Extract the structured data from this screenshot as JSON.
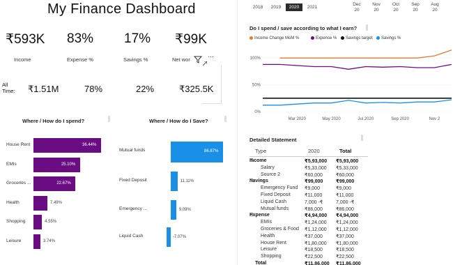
{
  "title": "My Finance Dashboard",
  "kpis": [
    {
      "value": "₹593K",
      "label": "Income"
    },
    {
      "value": "83%",
      "label": "Expense %"
    },
    {
      "value": "17%",
      "label": "Savings %"
    },
    {
      "value": "₹99K",
      "label": "Net wor"
    }
  ],
  "alltime": {
    "label": "All\nTime:",
    "values": [
      "₹1.51M",
      "78%",
      "22%",
      "₹325.5K"
    ]
  },
  "spend_chart": {
    "title": "Where / How do I spend?",
    "categories": [
      "House Rent",
      "EMIs",
      "Groceries ...",
      "Health",
      "Shopping",
      "Leisure"
    ],
    "values": [
      36.44,
      25.1,
      22.67,
      7.49,
      4.55,
      3.74
    ],
    "labels": [
      "36.44%",
      "25.10%",
      "22.67%",
      "7.49%",
      "4.55%",
      "3.74%"
    ],
    "color": "#6a0d83"
  },
  "save_chart": {
    "title": "Where / How do I Save?",
    "categories": [
      "Mutual funds",
      "Fixed Deposit",
      "Emergency ...",
      "Liquid Cash"
    ],
    "values": [
      86.87,
      11.11,
      9.09,
      -7.07
    ],
    "labels": [
      "86.87%",
      "11.11%",
      "9.09%",
      "-7.07%"
    ],
    "color": "#1a8fe8"
  },
  "years": [
    "2018",
    "2019",
    "2020",
    "2021"
  ],
  "selected_year": "2020",
  "months": [
    [
      "Dec",
      "20"
    ],
    [
      "Nov",
      "20"
    ],
    [
      "Oct",
      "20"
    ],
    [
      "Sep",
      "20"
    ],
    [
      "Aug",
      "20"
    ]
  ],
  "line_chart": {
    "title": "Do I spend / save according to what I earn?",
    "legend": [
      {
        "name": "Income Change MoM %",
        "color": "#e07b39"
      },
      {
        "name": "Expense %",
        "color": "#6a0d83"
      },
      {
        "name": "Savings target",
        "color": "#111111"
      },
      {
        "name": "Savings %",
        "color": "#1a8fe8"
      }
    ],
    "y_ticks": [
      "100%",
      "50%",
      "0%"
    ],
    "x_ticks": [
      "Mar 2020",
      "May 2020",
      "Jul 2020",
      "Sep 2020",
      "Nov 2"
    ],
    "chart_data": {
      "type": "line",
      "x": [
        "Jan 2020",
        "Feb 2020",
        "Mar 2020",
        "Apr 2020",
        "May 2020",
        "Jun 2020",
        "Jul 2020",
        "Aug 2020",
        "Sep 2020",
        "Oct 2020",
        "Nov 2020",
        "Dec 2020"
      ],
      "ylim": [
        0,
        125
      ],
      "series": [
        {
          "name": "Income Change MoM %",
          "values": [
            null,
            100,
            100,
            100,
            100,
            100,
            100,
            100,
            100,
            100,
            104,
            115
          ]
        },
        {
          "name": "Expense %",
          "values": [
            88,
            88,
            86,
            84,
            84,
            79,
            84,
            83,
            84,
            82,
            82,
            88
          ]
        },
        {
          "name": "Savings target",
          "values": [
            25,
            25,
            25,
            25,
            25,
            25,
            25,
            25,
            25,
            25,
            25,
            25
          ]
        },
        {
          "name": "Savings %",
          "values": [
            12,
            12,
            14,
            16,
            16,
            21,
            16,
            17,
            16,
            18,
            18,
            22
          ]
        }
      ]
    }
  },
  "statement": {
    "title": "Detailed Statement",
    "headers": [
      "Type",
      "2020",
      "Total"
    ],
    "rows": [
      {
        "type": "Income",
        "v2020": "₹5,93,000",
        "total": "₹5,93,000",
        "level": 0
      },
      {
        "type": "Salary",
        "v2020": "₹5,33,000",
        "total": "₹5,33,000",
        "level": 1
      },
      {
        "type": "Source 2",
        "v2020": "₹60,000",
        "total": "₹60,000",
        "level": 1
      },
      {
        "type": "Savings",
        "v2020": "₹99,000",
        "total": "₹99,000",
        "level": 0
      },
      {
        "type": "Emergency Fund",
        "v2020": "₹9,000",
        "total": "₹9,000",
        "level": 1
      },
      {
        "type": "Fixed Deposit",
        "v2020": "₹11,000",
        "total": "₹11,000",
        "level": 1
      },
      {
        "type": "Liquid Cash",
        "v2020": "7,000 -₹",
        "total": "7,000 -₹",
        "level": 1
      },
      {
        "type": "Mutual funds",
        "v2020": "₹86,000",
        "total": "₹86,000",
        "level": 1
      },
      {
        "type": "Expense",
        "v2020": "₹4,94,000",
        "total": "₹4,94,000",
        "level": 0
      },
      {
        "type": "EMIs",
        "v2020": "₹1,24,000",
        "total": "₹1,24,000",
        "level": 1
      },
      {
        "type": "Groceries & Food",
        "v2020": "₹1,12,000",
        "total": "₹1,12,000",
        "level": 1
      },
      {
        "type": "Health",
        "v2020": "₹37,000",
        "total": "₹37,000",
        "level": 1
      },
      {
        "type": "House Rent",
        "v2020": "₹1,80,000",
        "total": "₹1,80,000",
        "level": 1
      },
      {
        "type": "Leisure",
        "v2020": "₹18,500",
        "total": "₹18,500",
        "level": 1
      },
      {
        "type": "Shopping",
        "v2020": "₹22,500",
        "total": "₹22,500",
        "level": 1
      },
      {
        "type": "Total",
        "v2020": "₹11,86,000",
        "total": "₹11,86,000",
        "level": -1
      }
    ]
  }
}
